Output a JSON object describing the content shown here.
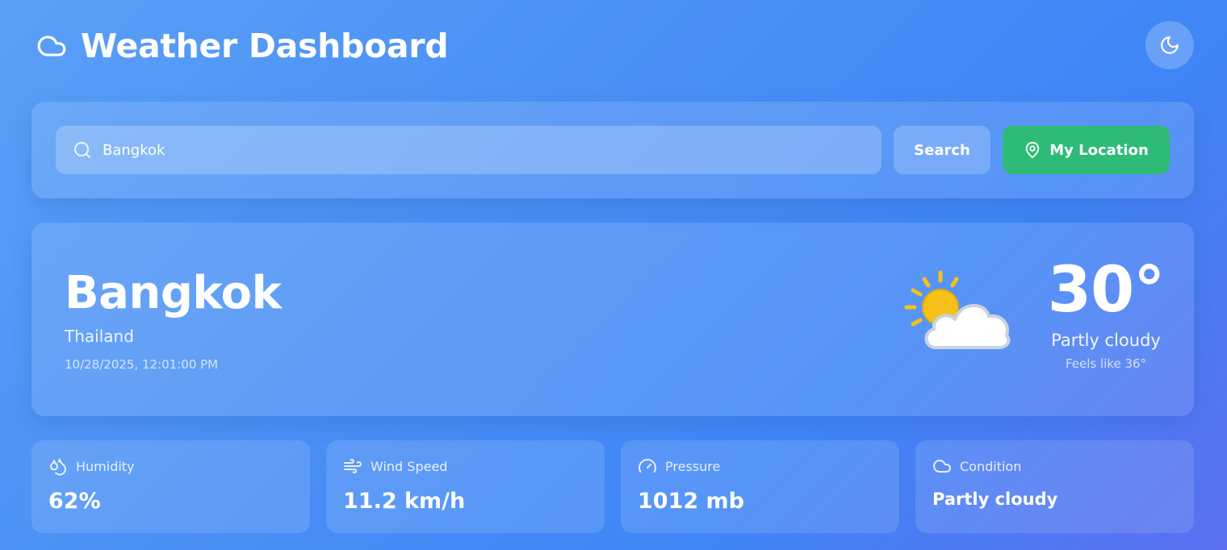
{
  "header": {
    "title": "Weather Dashboard",
    "logo_icon": "cloud-icon",
    "theme_toggle_icon": "moon-icon"
  },
  "search": {
    "value": "Bangkok",
    "search_icon": "search-icon",
    "search_button_label": "Search",
    "location_button_label": "My Location",
    "location_icon": "map-pin-icon"
  },
  "current": {
    "city": "Bangkok",
    "country": "Thailand",
    "local_time": "10/28/2025, 12:01:00 PM",
    "temperature": "30°",
    "condition": "Partly cloudy",
    "feels_like": "Feels like 36°",
    "weather_icon": "partly-cloudy-icon"
  },
  "stats": [
    {
      "label": "Humidity",
      "value": "62%",
      "icon": "droplets-icon"
    },
    {
      "label": "Wind Speed",
      "value": "11.2 km/h",
      "icon": "wind-icon"
    },
    {
      "label": "Pressure",
      "value": "1012 mb",
      "icon": "gauge-icon"
    },
    {
      "label": "Condition",
      "value": "Partly cloudy",
      "icon": "cloud-icon"
    }
  ],
  "colors": {
    "background_start": "#5aa0f7",
    "background_end": "#5b6ff0",
    "location_button": "#2ebb78",
    "sun": "#f6c219",
    "text": "#ffffff"
  }
}
